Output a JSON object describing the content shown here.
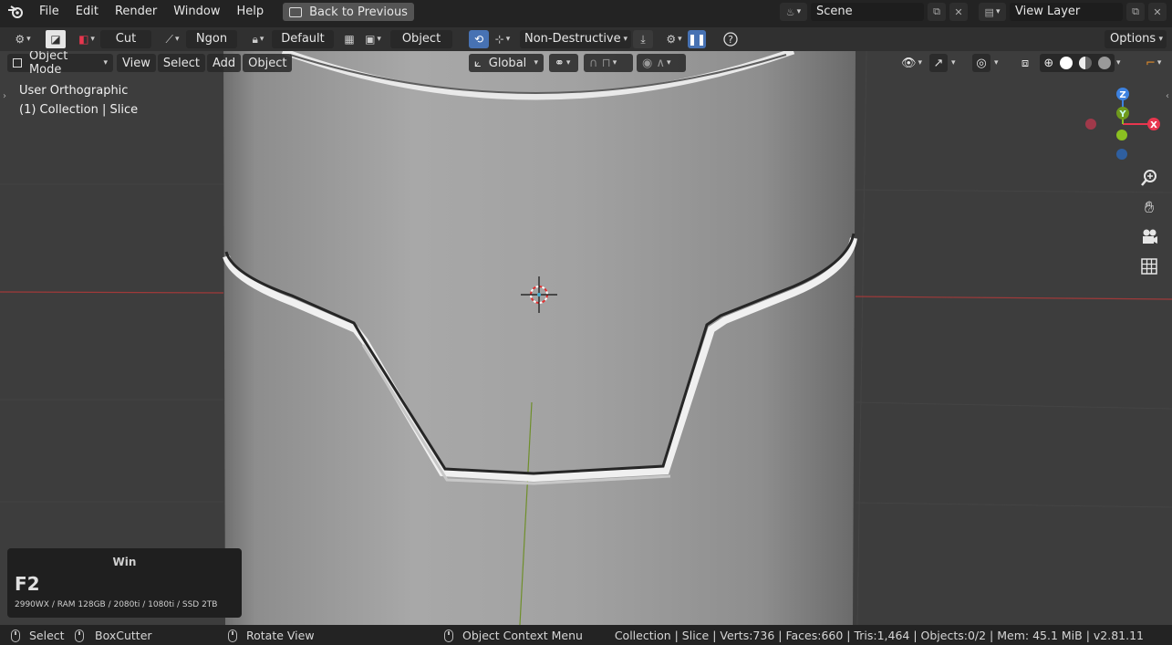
{
  "topbar": {
    "app_icon": "blender-logo-icon",
    "menus": [
      "File",
      "Edit",
      "Render",
      "Window",
      "Help"
    ],
    "back_button": "Back to Previous",
    "scene_label": "Scene",
    "view_layer_label": "View Layer"
  },
  "toolbar": {
    "cut_label": "Cut",
    "ngon_label": "Ngon",
    "default_label": "Default",
    "object_label": "Object",
    "non_destructive_label": "Non-Destructive",
    "options_label": "Options"
  },
  "viewport_header": {
    "mode_label": "Object Mode",
    "menus": [
      "View",
      "Select",
      "Add",
      "Object"
    ],
    "orientation_label": "Global"
  },
  "viewport": {
    "view_name": "User Orthographic",
    "collection_info": "(1) Collection | Slice",
    "gizmo": {
      "z": "Z",
      "y": "Y",
      "x": "X"
    }
  },
  "operator_panel": {
    "title": "Win",
    "key": "F2",
    "specs": "2990WX / RAM 128GB / 2080ti / 1080ti / SSD 2TB"
  },
  "statusbar": {
    "select": "Select",
    "boxcutter": "BoxCutter",
    "rotate_view": "Rotate View",
    "context_menu": "Object Context Menu",
    "stats": "Collection | Slice | Verts:736 | Faces:660 | Tris:1,464 | Objects:0/2 | Mem: 45.1 MiB | v2.81.11"
  },
  "colors": {
    "accent_blue": "#4772b3",
    "x_axis": "#e8364e",
    "y_axis": "#8bc021",
    "z_axis": "#3d82e0"
  }
}
